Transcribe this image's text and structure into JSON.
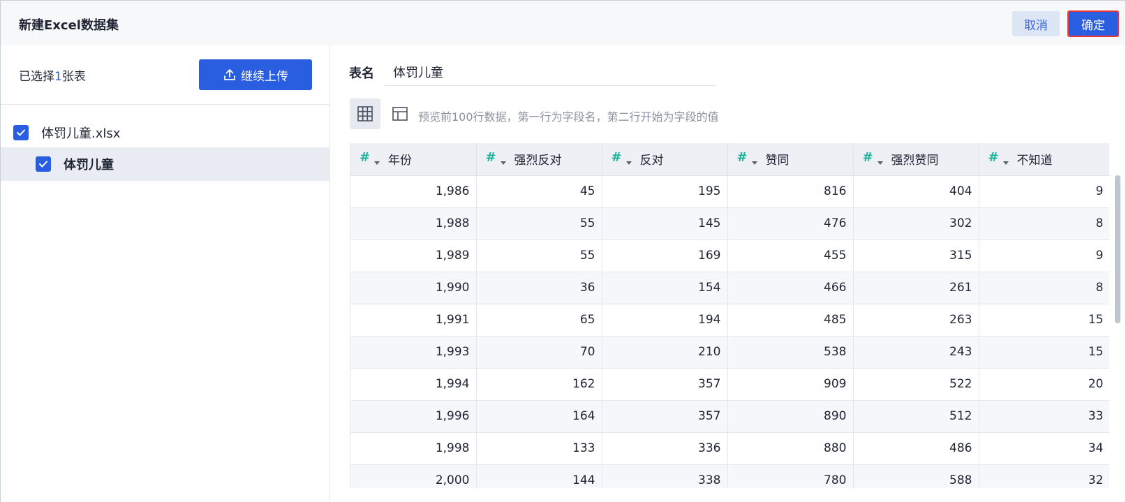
{
  "dialog": {
    "title": "新建Excel数据集",
    "cancel_label": "取消",
    "ok_label": "确定"
  },
  "left": {
    "selected_prefix": "已选择",
    "selected_count": "1",
    "selected_suffix": "张表",
    "upload_label": "继续上传",
    "file_name": "体罚儿童.xlsx",
    "sheet_name": "体罚儿童"
  },
  "right": {
    "table_name_label": "表名",
    "table_name_value": "体罚儿童",
    "preview_hint": "预览前100行数据，第一行为字段名，第二行开始为字段的值"
  },
  "table": {
    "columns": [
      "年份",
      "强烈反对",
      "反对",
      "赞同",
      "强烈赞同",
      "不知道"
    ],
    "rows": [
      [
        "1,986",
        "45",
        "195",
        "816",
        "404",
        "9"
      ],
      [
        "1,988",
        "55",
        "145",
        "476",
        "302",
        "8"
      ],
      [
        "1,989",
        "55",
        "169",
        "455",
        "315",
        "9"
      ],
      [
        "1,990",
        "36",
        "154",
        "466",
        "261",
        "8"
      ],
      [
        "1,991",
        "65",
        "194",
        "485",
        "263",
        "15"
      ],
      [
        "1,993",
        "70",
        "210",
        "538",
        "243",
        "15"
      ],
      [
        "1,994",
        "162",
        "357",
        "909",
        "522",
        "20"
      ],
      [
        "1,996",
        "164",
        "357",
        "890",
        "512",
        "33"
      ],
      [
        "1,998",
        "133",
        "336",
        "880",
        "486",
        "34"
      ],
      [
        "2,000",
        "144",
        "338",
        "780",
        "588",
        "32"
      ]
    ]
  },
  "colors": {
    "primary": "#2a5ee0",
    "field_type_icon": "#1fb29a",
    "ok_outline": "#e8373a"
  },
  "icons": {
    "field_type": "hash-icon",
    "upload": "upload-icon",
    "grid_view": "grid-view-icon",
    "layout_view": "layout-view-icon",
    "checkbox": "checkbox-checked-icon"
  }
}
